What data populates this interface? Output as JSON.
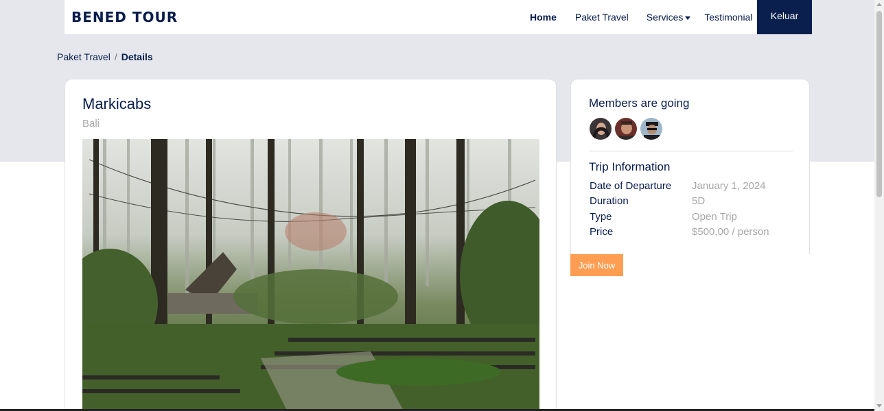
{
  "nav": {
    "brand": "BENED TOUR",
    "links": [
      "Home",
      "Paket Travel",
      "Services",
      "Testimonial"
    ],
    "logout_label": "Keluar"
  },
  "breadcrumb": {
    "parent": "Paket Travel",
    "separator": "/",
    "current": "Details"
  },
  "package": {
    "title": "Markicabs",
    "location": "Bali",
    "image_icon": "forest-photo"
  },
  "sidebar": {
    "members_title": "Members are going",
    "trip_title": "Trip Information",
    "info": [
      {
        "label": "Date of Departure",
        "value": "January 1, 2024"
      },
      {
        "label": "Duration",
        "value": "5D"
      },
      {
        "label": "Type",
        "value": "Open Trip"
      },
      {
        "label": "Price",
        "value": "$500,00 / person"
      }
    ],
    "join_label": "Join Now"
  },
  "colors": {
    "navy": "#071c4d",
    "accent": "#ff9e53",
    "muted": "#a7a7a7"
  }
}
